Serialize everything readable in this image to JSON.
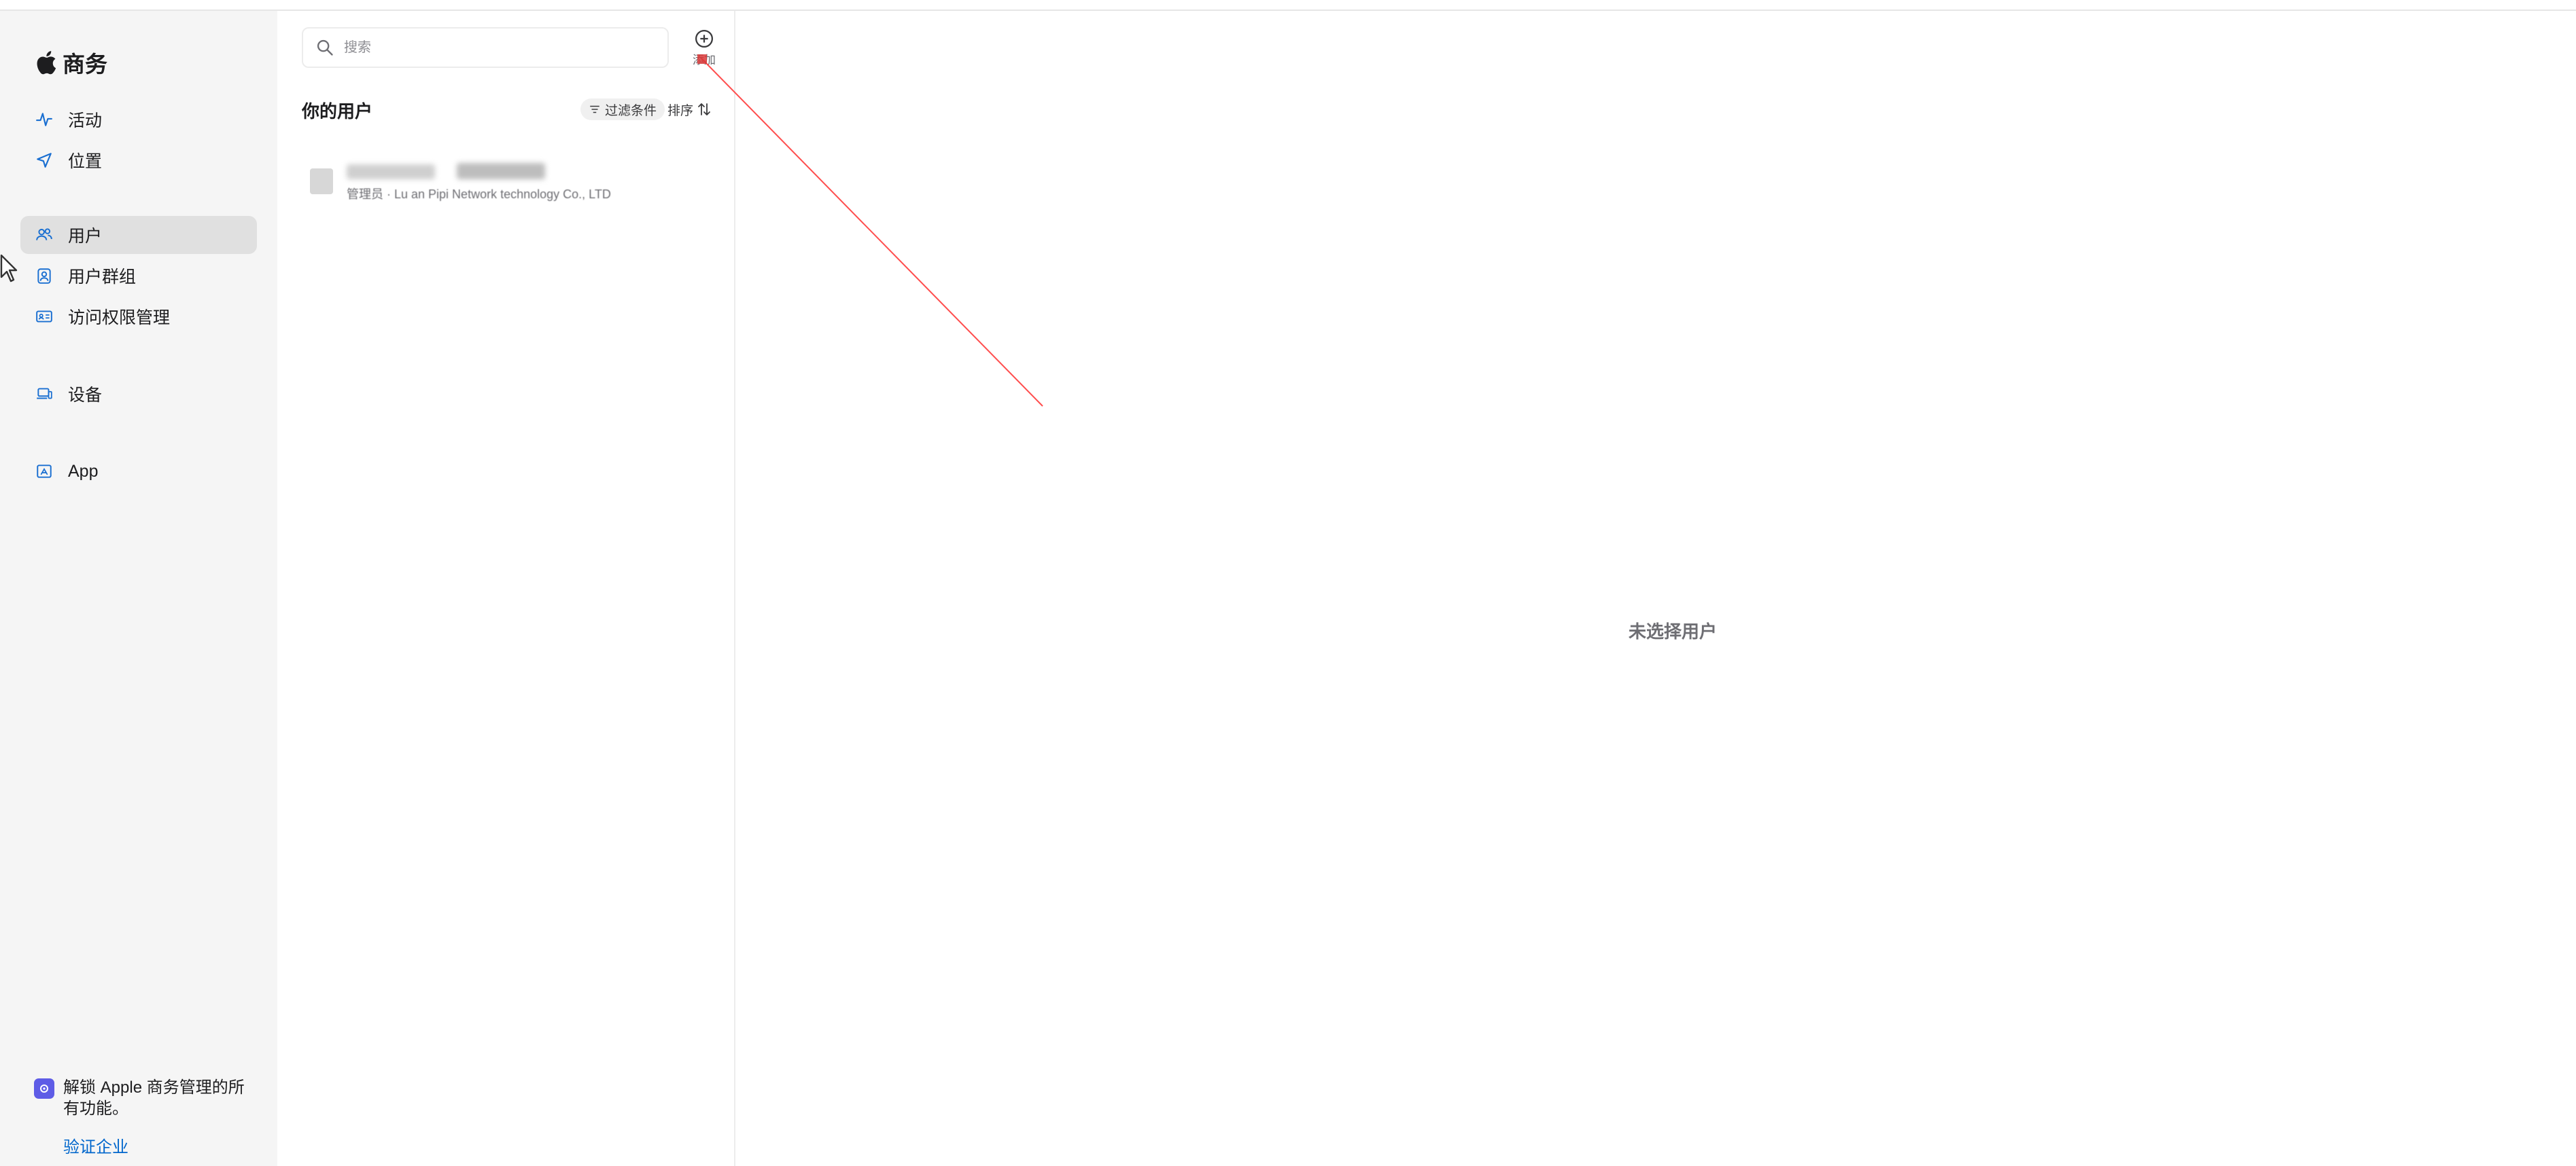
{
  "sidebar": {
    "brand_label": "商务",
    "nav": {
      "activity": "活动",
      "location": "位置",
      "users": "用户",
      "user_groups": "用户群组",
      "access_management": "访问权限管理",
      "devices": "设备",
      "apps": "App"
    },
    "active_item": "users",
    "promo": {
      "text": "解锁 Apple 商务管理的所有功能。",
      "link": "验证企业"
    }
  },
  "list": {
    "search_placeholder": "搜索",
    "add_label": "添加",
    "title": "你的用户",
    "filter_label": "过滤条件",
    "sort_label": "排序",
    "users": [
      {
        "subtitle": "管理员 · Lu an Pipi Network technology Co., LTD"
      }
    ]
  },
  "detail": {
    "empty_text": "未选择用户"
  },
  "colors": {
    "accent": "#0066cc",
    "icon_blue": "#1a6fd1",
    "sidebar_bg": "#f5f5f5",
    "selected_bg": "#e0e0e0",
    "promo_icon": "#5e5ce6",
    "annotation_line": "#ff4d4d"
  }
}
